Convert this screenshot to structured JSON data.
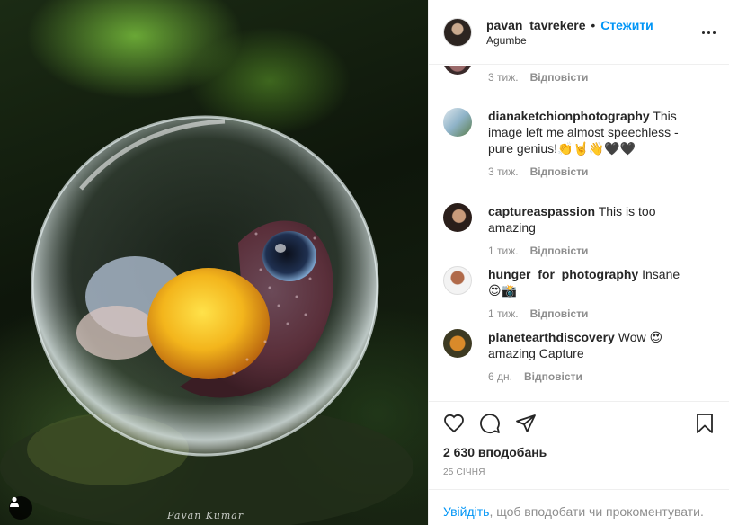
{
  "post": {
    "username": "pavan_tavrekere",
    "dot": "•",
    "follow_label": "Стежити",
    "location": "Agumbe",
    "photo_signature": "Pavan Kumar"
  },
  "comments": [
    {
      "username": "",
      "text": "",
      "time": "3 тиж.",
      "reply_label": "Відповісти"
    },
    {
      "username": "dianaketchionphotography",
      "text": "This image left me almost speechless - pure genius!👏🤘👋🖤🖤",
      "time": "3 тиж.",
      "reply_label": "Відповісти"
    },
    {
      "username": "captureaspassion",
      "text": "This is too amazing",
      "time": "1 тиж.",
      "reply_label": "Відповісти"
    },
    {
      "username": "hunger_for_photography",
      "text": "Insane 😍📸",
      "time": "1 тиж.",
      "reply_label": "Відповісти"
    },
    {
      "username": "planetearthdiscovery",
      "text": "Wow 😍 amazing Capture",
      "time": "6 дн.",
      "reply_label": "Відповісти"
    }
  ],
  "actions": {
    "likes": "2 630 вподобань",
    "date": "25 СІЧНЯ"
  },
  "login_bar": {
    "login_label": "Увійдіть",
    "rest": ", щоб вподобати чи прокоментувати."
  },
  "icons": [
    "user-tag-icon",
    "more-options-icon",
    "heart-icon",
    "comment-icon",
    "share-icon",
    "bookmark-icon"
  ],
  "colors": {
    "link_blue": "#0095f6",
    "text": "#262626",
    "muted": "#8e8e8e",
    "border": "#efefef"
  }
}
